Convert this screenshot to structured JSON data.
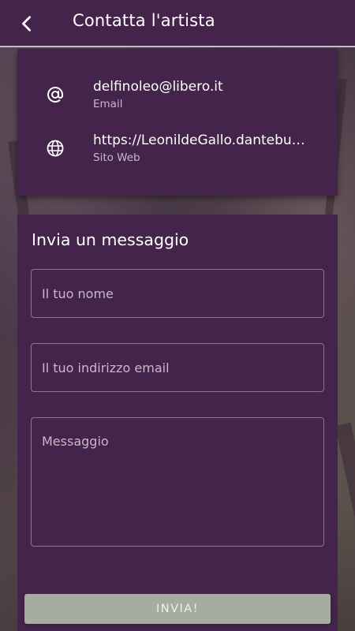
{
  "header": {
    "title": "Contatta l'artista",
    "back_icon": "chevron-left-icon"
  },
  "contact": {
    "email": {
      "value": "delfinoleo@libero.it",
      "label": "Email",
      "icon": "at-sign-icon"
    },
    "website": {
      "value": "https://LeonildeGallo.dantebu…",
      "label": "Sito Web",
      "icon": "globe-icon"
    }
  },
  "form": {
    "heading": "Invia un messaggio",
    "name_placeholder": "Il tuo nome",
    "email_placeholder": "Il tuo indirizzo email",
    "message_placeholder": "Messaggio",
    "submit_label": "INVIA!"
  },
  "colors": {
    "primary": "#44244a",
    "button": "#a4ad9f",
    "secondary_text": "#c7b8c9"
  }
}
